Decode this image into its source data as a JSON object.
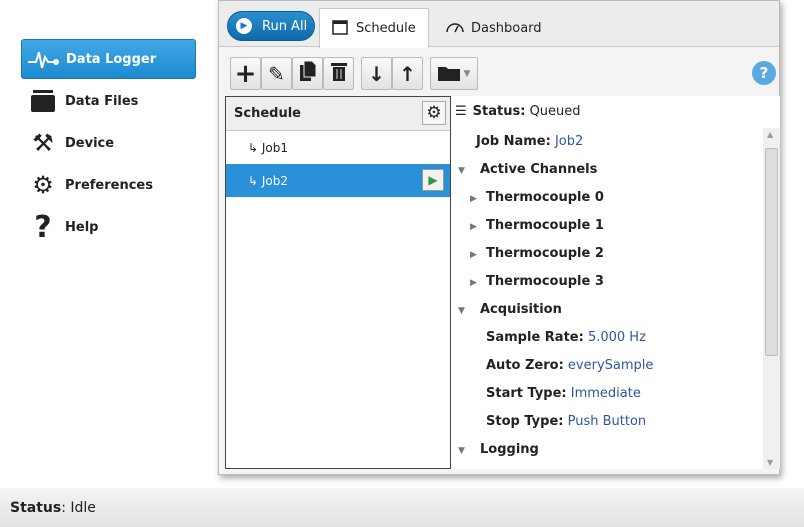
{
  "sidebar": {
    "items": [
      {
        "label": "Data Logger",
        "icon": "waveform-icon",
        "active": true
      },
      {
        "label": "Data Files",
        "icon": "folder-icon"
      },
      {
        "label": "Device",
        "icon": "tools-icon"
      },
      {
        "label": "Preferences",
        "icon": "gear-icon"
      },
      {
        "label": "Help",
        "icon": "question-icon"
      }
    ]
  },
  "header": {
    "run_all": "Run All",
    "tabs": [
      {
        "label": "Schedule",
        "active": true
      },
      {
        "label": "Dashboard"
      }
    ]
  },
  "toolbar": {
    "help": "?"
  },
  "schedule": {
    "title": "Schedule",
    "jobs": [
      {
        "label": "↳ Job1"
      },
      {
        "label": "↳ Job2",
        "selected": true
      }
    ]
  },
  "details": {
    "status_label": "Status:",
    "status_value": "Queued",
    "job_name_label": "Job Name:",
    "job_name_value": "Job2",
    "active_channels": "Active Channels",
    "channels": [
      "Thermocouple 0",
      "Thermocouple 1",
      "Thermocouple 2",
      "Thermocouple 3"
    ],
    "acquisition": "Acquisition",
    "sample_rate_label": "Sample Rate:",
    "sample_rate_value": "5.000 Hz",
    "auto_zero_label": "Auto Zero:",
    "auto_zero_value": "everySample",
    "start_type_label": "Start Type:",
    "start_type_value": "Immediate",
    "stop_type_label": "Stop Type:",
    "stop_type_value": "Push Button",
    "logging": "Logging"
  },
  "statusbar": {
    "label": "Status",
    "value": ": Idle"
  },
  "colors": {
    "accent": "#2a90d8",
    "value_text": "#2b57a0"
  }
}
